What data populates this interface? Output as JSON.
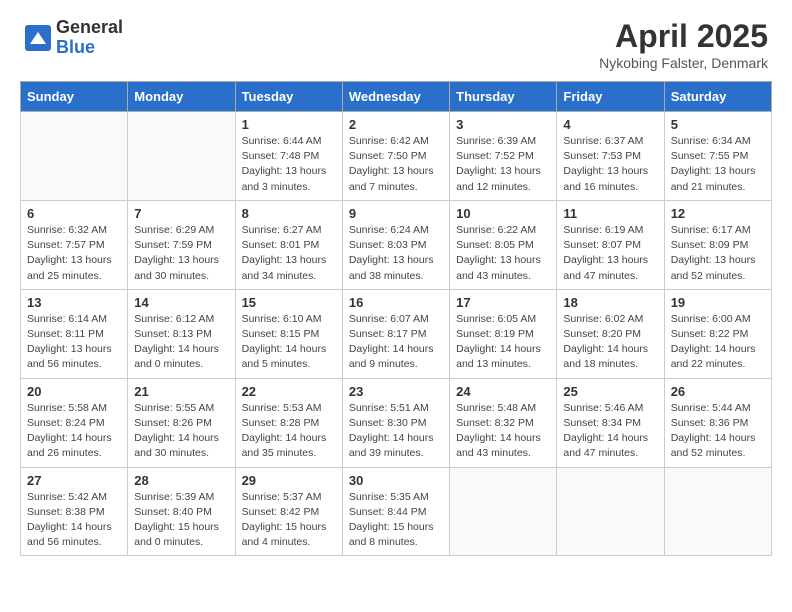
{
  "logo": {
    "general": "General",
    "blue": "Blue"
  },
  "title": {
    "month": "April 2025",
    "location": "Nykobing Falster, Denmark"
  },
  "weekdays": [
    "Sunday",
    "Monday",
    "Tuesday",
    "Wednesday",
    "Thursday",
    "Friday",
    "Saturday"
  ],
  "weeks": [
    [
      {
        "day": "",
        "info": ""
      },
      {
        "day": "",
        "info": ""
      },
      {
        "day": "1",
        "sunrise": "6:44 AM",
        "sunset": "7:48 PM",
        "daylight": "13 hours and 3 minutes."
      },
      {
        "day": "2",
        "sunrise": "6:42 AM",
        "sunset": "7:50 PM",
        "daylight": "13 hours and 7 minutes."
      },
      {
        "day": "3",
        "sunrise": "6:39 AM",
        "sunset": "7:52 PM",
        "daylight": "13 hours and 12 minutes."
      },
      {
        "day": "4",
        "sunrise": "6:37 AM",
        "sunset": "7:53 PM",
        "daylight": "13 hours and 16 minutes."
      },
      {
        "day": "5",
        "sunrise": "6:34 AM",
        "sunset": "7:55 PM",
        "daylight": "13 hours and 21 minutes."
      }
    ],
    [
      {
        "day": "6",
        "sunrise": "6:32 AM",
        "sunset": "7:57 PM",
        "daylight": "13 hours and 25 minutes."
      },
      {
        "day": "7",
        "sunrise": "6:29 AM",
        "sunset": "7:59 PM",
        "daylight": "13 hours and 30 minutes."
      },
      {
        "day": "8",
        "sunrise": "6:27 AM",
        "sunset": "8:01 PM",
        "daylight": "13 hours and 34 minutes."
      },
      {
        "day": "9",
        "sunrise": "6:24 AM",
        "sunset": "8:03 PM",
        "daylight": "13 hours and 38 minutes."
      },
      {
        "day": "10",
        "sunrise": "6:22 AM",
        "sunset": "8:05 PM",
        "daylight": "13 hours and 43 minutes."
      },
      {
        "day": "11",
        "sunrise": "6:19 AM",
        "sunset": "8:07 PM",
        "daylight": "13 hours and 47 minutes."
      },
      {
        "day": "12",
        "sunrise": "6:17 AM",
        "sunset": "8:09 PM",
        "daylight": "13 hours and 52 minutes."
      }
    ],
    [
      {
        "day": "13",
        "sunrise": "6:14 AM",
        "sunset": "8:11 PM",
        "daylight": "13 hours and 56 minutes."
      },
      {
        "day": "14",
        "sunrise": "6:12 AM",
        "sunset": "8:13 PM",
        "daylight": "14 hours and 0 minutes."
      },
      {
        "day": "15",
        "sunrise": "6:10 AM",
        "sunset": "8:15 PM",
        "daylight": "14 hours and 5 minutes."
      },
      {
        "day": "16",
        "sunrise": "6:07 AM",
        "sunset": "8:17 PM",
        "daylight": "14 hours and 9 minutes."
      },
      {
        "day": "17",
        "sunrise": "6:05 AM",
        "sunset": "8:19 PM",
        "daylight": "14 hours and 13 minutes."
      },
      {
        "day": "18",
        "sunrise": "6:02 AM",
        "sunset": "8:20 PM",
        "daylight": "14 hours and 18 minutes."
      },
      {
        "day": "19",
        "sunrise": "6:00 AM",
        "sunset": "8:22 PM",
        "daylight": "14 hours and 22 minutes."
      }
    ],
    [
      {
        "day": "20",
        "sunrise": "5:58 AM",
        "sunset": "8:24 PM",
        "daylight": "14 hours and 26 minutes."
      },
      {
        "day": "21",
        "sunrise": "5:55 AM",
        "sunset": "8:26 PM",
        "daylight": "14 hours and 30 minutes."
      },
      {
        "day": "22",
        "sunrise": "5:53 AM",
        "sunset": "8:28 PM",
        "daylight": "14 hours and 35 minutes."
      },
      {
        "day": "23",
        "sunrise": "5:51 AM",
        "sunset": "8:30 PM",
        "daylight": "14 hours and 39 minutes."
      },
      {
        "day": "24",
        "sunrise": "5:48 AM",
        "sunset": "8:32 PM",
        "daylight": "14 hours and 43 minutes."
      },
      {
        "day": "25",
        "sunrise": "5:46 AM",
        "sunset": "8:34 PM",
        "daylight": "14 hours and 47 minutes."
      },
      {
        "day": "26",
        "sunrise": "5:44 AM",
        "sunset": "8:36 PM",
        "daylight": "14 hours and 52 minutes."
      }
    ],
    [
      {
        "day": "27",
        "sunrise": "5:42 AM",
        "sunset": "8:38 PM",
        "daylight": "14 hours and 56 minutes."
      },
      {
        "day": "28",
        "sunrise": "5:39 AM",
        "sunset": "8:40 PM",
        "daylight": "15 hours and 0 minutes."
      },
      {
        "day": "29",
        "sunrise": "5:37 AM",
        "sunset": "8:42 PM",
        "daylight": "15 hours and 4 minutes."
      },
      {
        "day": "30",
        "sunrise": "5:35 AM",
        "sunset": "8:44 PM",
        "daylight": "15 hours and 8 minutes."
      },
      {
        "day": "",
        "info": ""
      },
      {
        "day": "",
        "info": ""
      },
      {
        "day": "",
        "info": ""
      }
    ]
  ]
}
